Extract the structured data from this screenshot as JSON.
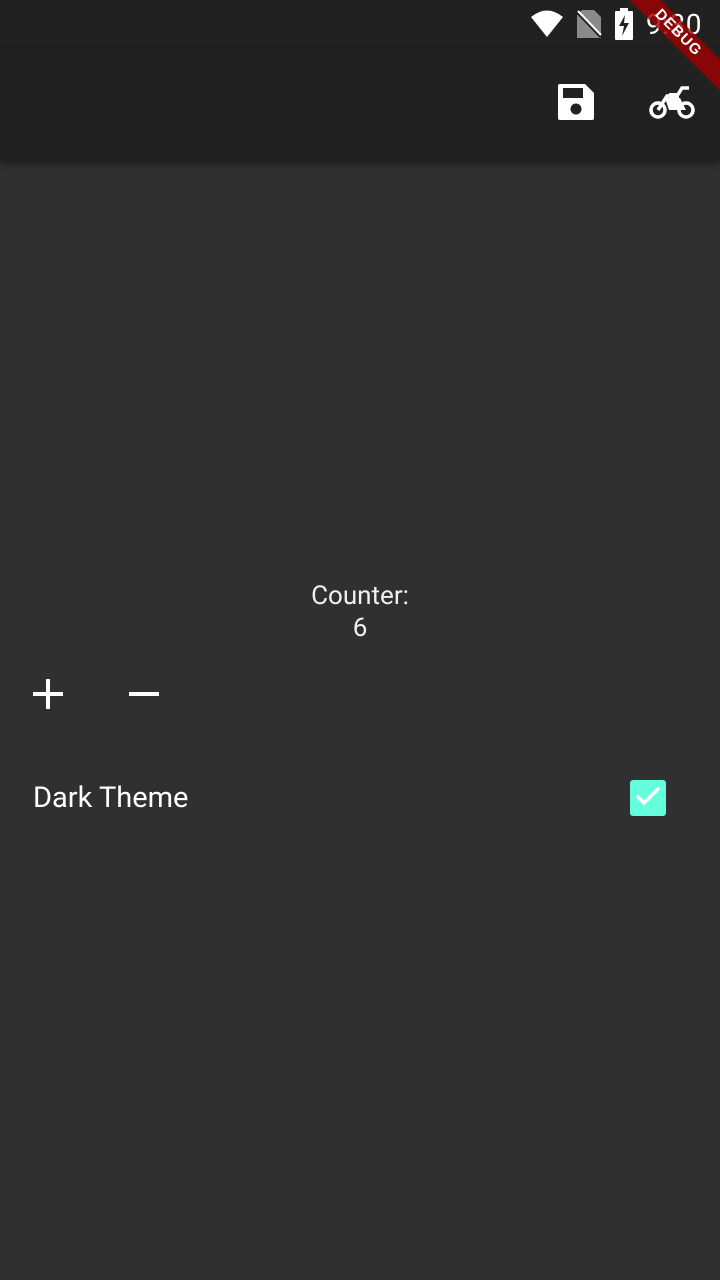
{
  "status_bar": {
    "time": "9:30",
    "icons": [
      "wifi-icon",
      "no-sim-icon",
      "battery-charging-icon"
    ]
  },
  "debug_banner": {
    "label": "DEBUG"
  },
  "app_bar": {
    "actions": [
      {
        "name": "save-icon",
        "interactable": true
      },
      {
        "name": "motorcycle-icon",
        "interactable": true
      }
    ]
  },
  "counter": {
    "label": "Counter:",
    "value": "6"
  },
  "controls": {
    "increment_icon": "plus-icon",
    "decrement_icon": "minus-icon"
  },
  "settings": {
    "dark_theme_label": "Dark Theme",
    "dark_theme_checked": true
  },
  "colors": {
    "background": "#303030",
    "app_bar": "#212121",
    "accent": "#64ffda",
    "debug_banner": "#a00000",
    "text": "#ffffff"
  }
}
